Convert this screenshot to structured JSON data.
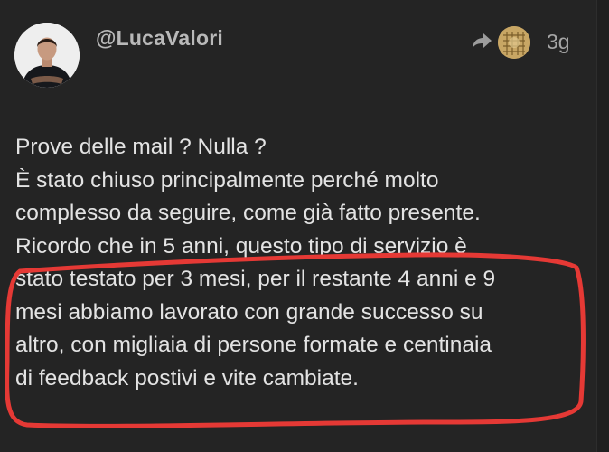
{
  "post": {
    "username": "@LucaValori",
    "time": "3g",
    "icons": {
      "share": "share-arrow-icon",
      "reader_avatar": "reader-avatar"
    },
    "lines": [
      "Prove delle mail ? Nulla ?",
      "È stato chiuso principalmente perché molto",
      "complesso da seguire, come già fatto presente.",
      "Ricordo che in 5 anni, questo tipo di servizio è",
      "stato testato per 3 mesi, per il restante 4 anni e 9",
      "mesi abbiamo lavorato con grande successo su",
      "altro, con migliaia di persone formate e centinaia",
      "di feedback postivi e vite cambiate."
    ]
  },
  "colors": {
    "background": "#242424",
    "text": "#e3e3e3",
    "username": "#b9b9b9",
    "annotation": "#e53935"
  }
}
